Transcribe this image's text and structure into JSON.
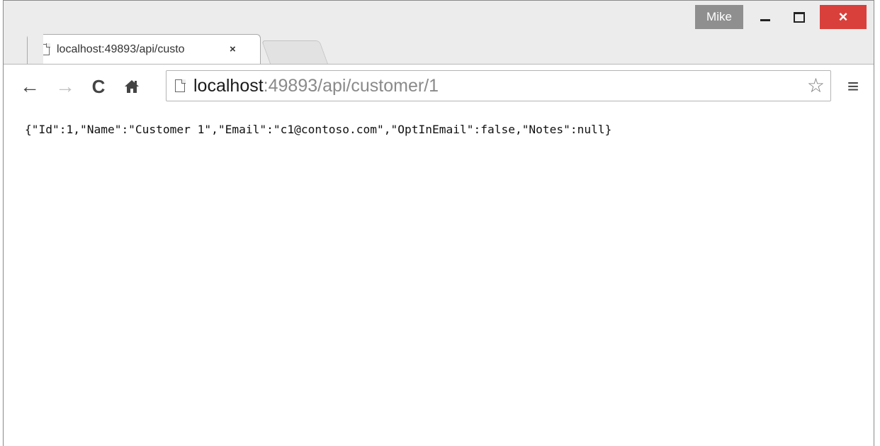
{
  "window": {
    "profile_name": "Mike",
    "controls": {
      "close_glyph": "×"
    }
  },
  "tab": {
    "title": "localhost:49893/api/custo",
    "close_glyph": "×",
    "icon": "page-icon"
  },
  "toolbar": {
    "back_glyph": "←",
    "forward_glyph": "→",
    "reload_glyph": "C",
    "home_glyph": "⌂",
    "menu_glyph": "≡",
    "star_glyph": "☆"
  },
  "omnibox": {
    "host": "localhost",
    "path": ":49893/api/customer/1"
  },
  "content": {
    "text": "{\"Id\":1,\"Name\":\"Customer 1\",\"Email\":\"c1@contoso.com\",\"OptInEmail\":false,\"Notes\":null}"
  },
  "colors": {
    "close_button": "#d9403b",
    "profile_badge": "#8f8f8f"
  }
}
